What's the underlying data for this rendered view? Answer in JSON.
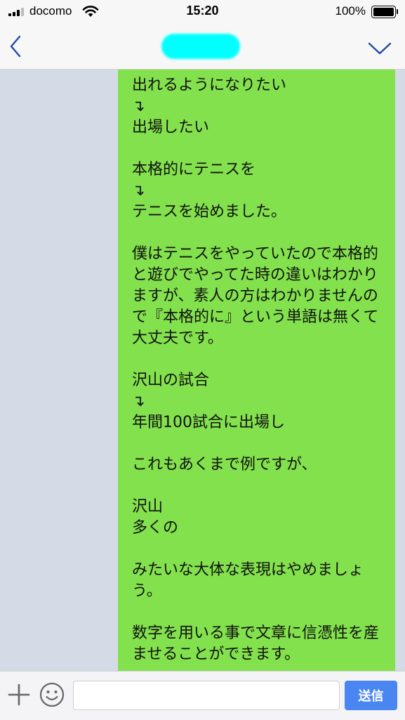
{
  "status_bar": {
    "carrier": "docomo",
    "time": "15:20",
    "battery_percent": "100%",
    "icons": [
      "signal-icon",
      "wifi-icon",
      "battery-icon"
    ]
  },
  "header": {
    "back_icon": "chevron-left-icon",
    "menu_icon": "chevron-down-icon",
    "contact_name_redacted_color": "#00ffff"
  },
  "chat": {
    "background_color": "#d4dbe6",
    "message": {
      "bubble_color": "#83e14d",
      "text": "出れるようになりたい\n↴\n出場したい\n\n本格的にテニスを\n↴\nテニスを始めました。\n\n僕はテニスをやっていたので本格的と遊びでやってた時の違いはわかりますが、素人の方はわかりませんので『本格的に』という単語は無くて大丈夫です。\n\n沢山の試合\n↴\n年間100試合に出場し\n\nこれもあくまで例ですが、\n\n沢山\n多くの\n\nみたいな大体な表現はやめましょう。\n\n数字を用いる事で文章に信憑性を産ませることができます。"
    }
  },
  "input_bar": {
    "plus_icon": "plus-icon",
    "emoji_icon": "smiley-icon",
    "input_value": "",
    "send_label": "送信",
    "send_color": "#4a86f2"
  }
}
